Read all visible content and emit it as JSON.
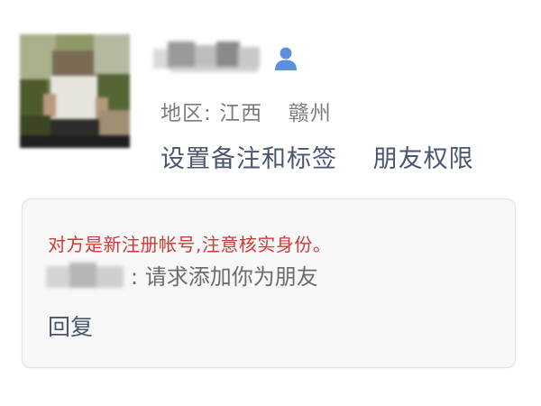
{
  "profile": {
    "region_label": "地区:",
    "region_province": "江西",
    "region_city": "赣州",
    "icon": "person-icon"
  },
  "actions": {
    "remark_tags": "设置备注和标签",
    "permissions": "朋友权限"
  },
  "request_card": {
    "warning": "对方是新注册帐号,注意核实身份。",
    "message": ": 请求添加你为朋友",
    "reply": "回复"
  },
  "colors": {
    "warning": "#cf3a35",
    "link": "#4a5670",
    "icon": "#5b8fe0",
    "secondary_text": "#7c7c7c"
  }
}
